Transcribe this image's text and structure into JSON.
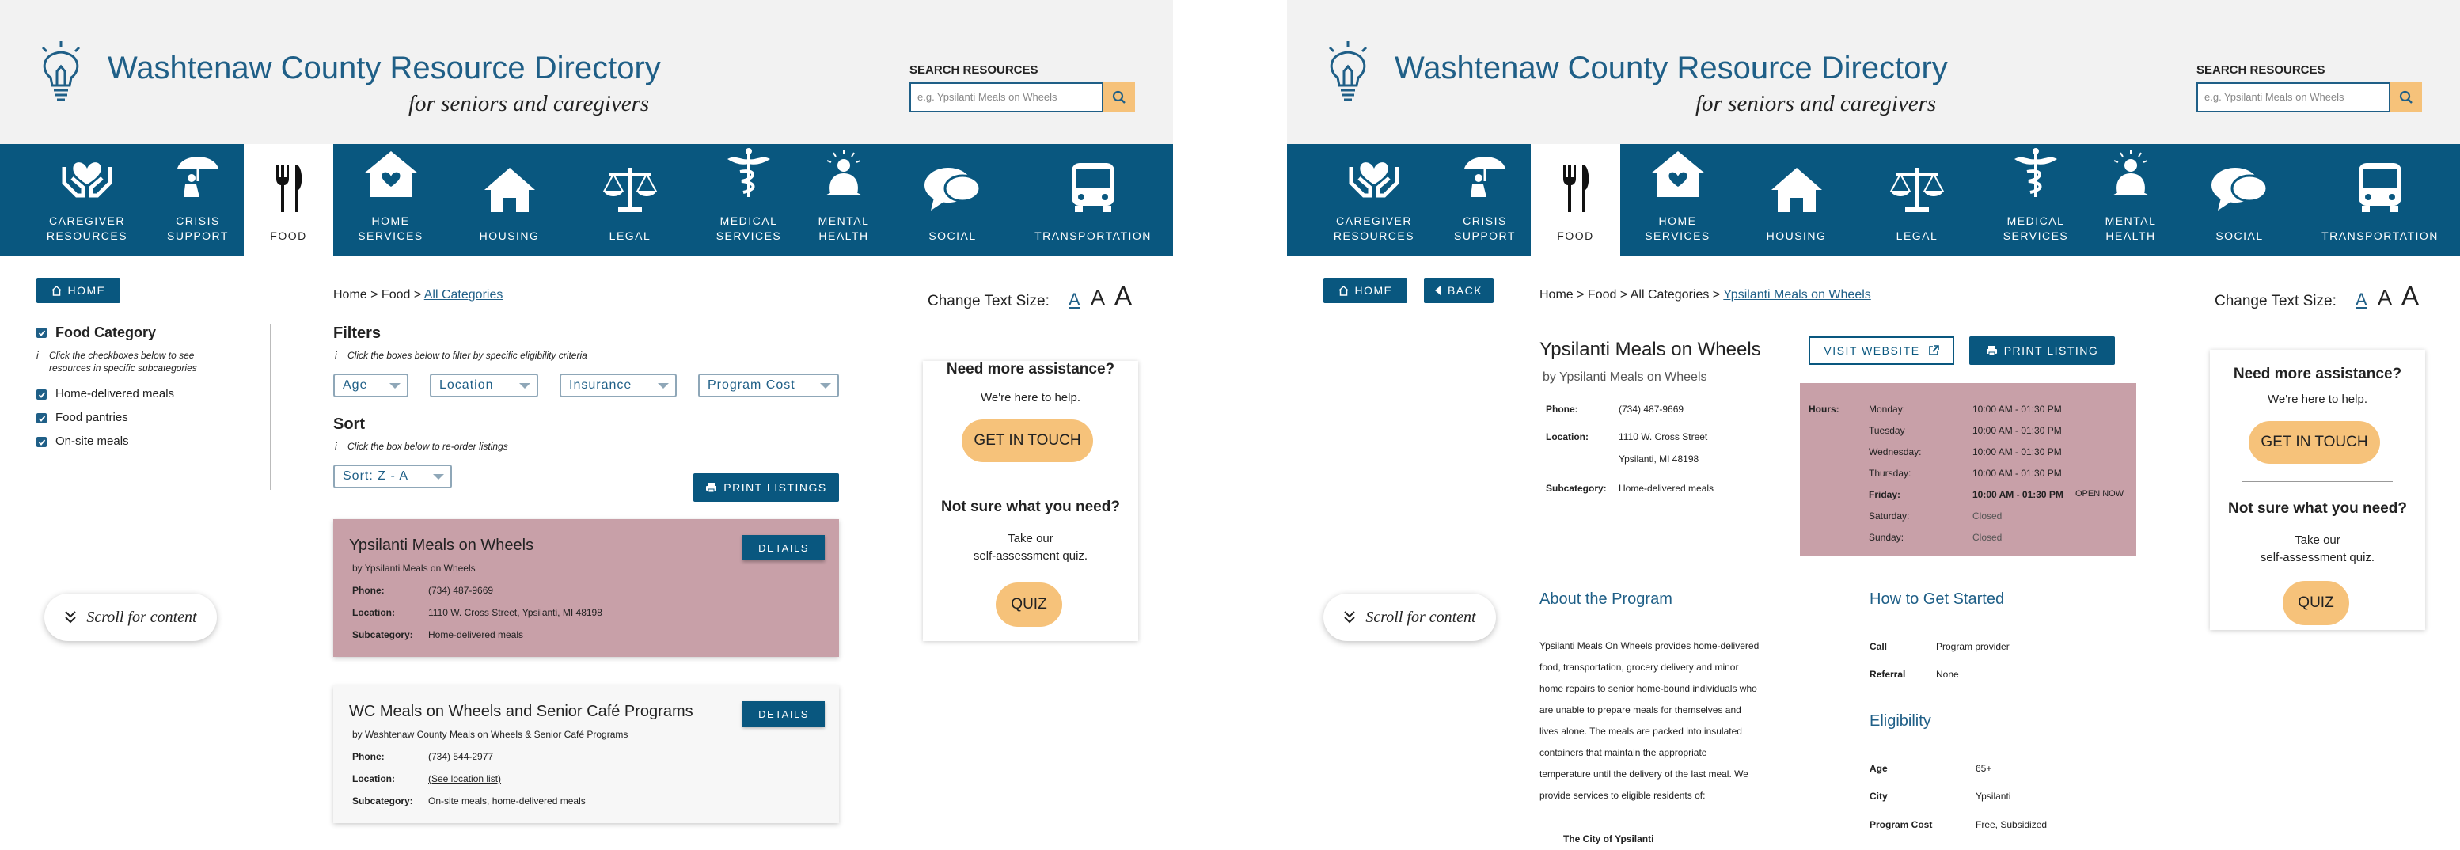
{
  "site": {
    "title": "Washtenaw County Resource Directory",
    "subtitle": "for seniors and caregivers",
    "search_label": "SEARCH RESOURCES",
    "search_placeholder": "e.g. Ypsilanti Meals on Wheels"
  },
  "nav": [
    {
      "label": "CAREGIVER\nRESOURCES",
      "icon": "caregiver-hands-heart-icon"
    },
    {
      "label": "CRISIS\nSUPPORT",
      "icon": "umbrella-person-icon"
    },
    {
      "label": "FOOD",
      "icon": "fork-knife-icon",
      "active": true
    },
    {
      "label": "HOME\nSERVICES",
      "icon": "home-heart-icon"
    },
    {
      "label": "HOUSING",
      "icon": "house-icon"
    },
    {
      "label": "LEGAL",
      "icon": "scales-icon"
    },
    {
      "label": "MEDICAL\nSERVICES",
      "icon": "caduceus-icon"
    },
    {
      "label": "MENTAL\nHEALTH",
      "icon": "meditation-icon"
    },
    {
      "label": "SOCIAL",
      "icon": "speech-bubbles-icon"
    },
    {
      "label": "TRANSPORTATION",
      "icon": "bus-icon"
    }
  ],
  "common": {
    "home_btn": "HOME",
    "back_btn": "BACK",
    "scroll_hint": "Scroll for content",
    "text_size_label": "Change Text Size:",
    "text_size_options": [
      "A",
      "A",
      "A"
    ]
  },
  "aside": {
    "assist_title": "Need more assistance?",
    "assist_sub": "We're here to help.",
    "touch_btn": "GET IN TOUCH",
    "quiz_title": "Not sure what you need?",
    "quiz_sub_1": "Take our",
    "quiz_sub_2": "self-assessment quiz.",
    "quiz_btn": "QUIZ"
  },
  "listing": {
    "breadcrumb": {
      "home": "Home",
      "food": "Food",
      "all": "All Categories"
    },
    "category_title": "Food Category",
    "category_note_1": "Click the checkboxes below to see",
    "category_note_2": "resources in specific subcategories",
    "subcategories": [
      "Home-delivered meals",
      "Food pantries",
      "On-site meals"
    ],
    "filters_title": "Filters",
    "filters_note": "Click the boxes below to filter by specific eligibility criteria",
    "filters": [
      "Age",
      "Location",
      "Insurance",
      "Program Cost"
    ],
    "sort_title": "Sort",
    "sort_note": "Click the box below to re-order listings",
    "sort_value": "Sort: Z - A",
    "print_btn": "PRINT LISTINGS",
    "details_btn": "DETAILS",
    "field_phone": "Phone:",
    "field_location": "Location:",
    "field_subcategory": "Subcategory:",
    "cards": [
      {
        "title": "Ypsilanti Meals on Wheels",
        "by": "by Ypsilanti Meals on Wheels",
        "phone": "(734) 487-9669",
        "location": "1110 W. Cross Street, Ypsilanti, MI 48198",
        "subcategory": "Home-delivered meals",
        "highlight": "#c8a0a8"
      },
      {
        "title": "WC Meals on Wheels and Senior Café Programs",
        "by": "by Washtenaw County Meals on Wheels & Senior Café Programs",
        "phone": "(734) 544-2977",
        "location": "(See location list)",
        "subcategory": "On-site meals, home-delivered meals",
        "highlight": "#f7f7f7"
      }
    ]
  },
  "detail": {
    "breadcrumb": {
      "home": "Home",
      "food": "Food",
      "all": "All Categories",
      "current": "Ypsilanti Meals on Wheels"
    },
    "title": "Ypsilanti Meals on Wheels",
    "by": "by Ypsilanti Meals on Wheels",
    "visit_btn": "VISIT WEBSITE",
    "print_btn": "PRINT LISTING",
    "phone_label": "Phone:",
    "phone": "(734) 487-9669",
    "location_label": "Location:",
    "location_1": "1110 W. Cross Street",
    "location_2": "Ypsilanti, MI 48198",
    "subcategory_label": "Subcategory:",
    "subcategory": "Home-delivered meals",
    "hours_label": "Hours:",
    "hours": [
      {
        "day": "Monday:",
        "time": "10:00 AM - 01:30 PM"
      },
      {
        "day": "Tuesday",
        "time": "10:00 AM - 01:30 PM"
      },
      {
        "day": "Wednesday:",
        "time": "10:00 AM - 01:30 PM"
      },
      {
        "day": "Thursday:",
        "time": "10:00 AM - 01:30 PM"
      },
      {
        "day": "Friday:",
        "time": "10:00 AM - 01:30 PM",
        "today": true,
        "status": "OPEN NOW"
      },
      {
        "day": "Saturday:",
        "time": "Closed"
      },
      {
        "day": "Sunday:",
        "time": "Closed"
      }
    ],
    "about_title": "About the Program",
    "about_lines": [
      "Ypsilanti Meals On Wheels provides home-delivered",
      "food, transportation, grocery delivery and minor",
      "home repairs to senior home-bound individuals who",
      "are unable to prepare meals for themselves and",
      "lives alone. The meals are packed into insulated",
      "containers that maintain the appropriate",
      "temperature until the delivery of the last meal. We",
      "provide services to eligible residents of:"
    ],
    "about_city": "The City of Ypsilanti",
    "start_title": "How to Get Started",
    "start": [
      {
        "k": "Call",
        "v": "Program provider"
      },
      {
        "k": "Referral",
        "v": "None"
      }
    ],
    "elig_title": "Eligibility",
    "elig": [
      {
        "k": "Age",
        "v": "65+"
      },
      {
        "k": "City",
        "v": "Ypsilanti"
      },
      {
        "k": "Program Cost",
        "v": "Free, Subsidized"
      }
    ]
  },
  "colors": {
    "brand": "#09577f",
    "accent": "#f6c27a",
    "highlight": "#c8a0a8"
  }
}
